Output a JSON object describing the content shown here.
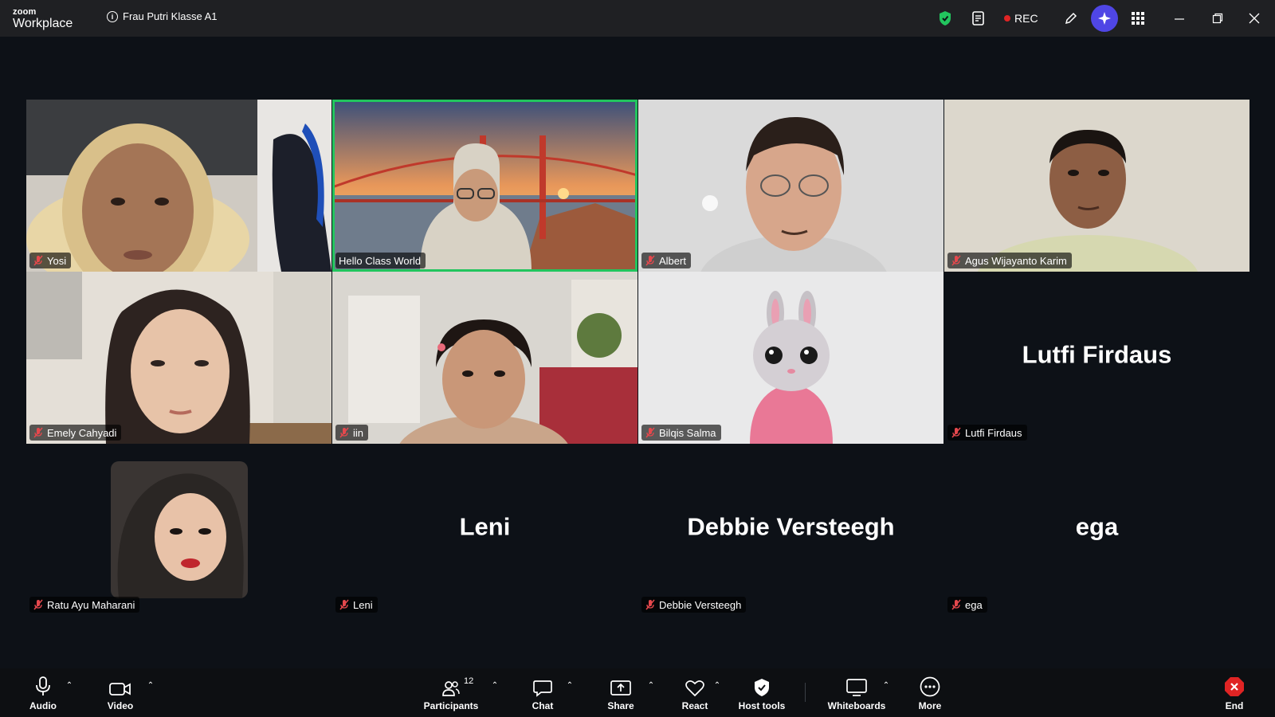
{
  "app": {
    "logo_line1": "zoom",
    "logo_line2": "Workplace"
  },
  "meeting": {
    "title": "Frau Putri Klasse A1"
  },
  "topbar": {
    "rec_label": "REC"
  },
  "participants": [
    {
      "name": "Yosi",
      "muted": true,
      "video": true,
      "scene": "yosi"
    },
    {
      "name": "Hello Class World",
      "muted": false,
      "video": true,
      "scene": "bridge",
      "active_speaker": true
    },
    {
      "name": "Albert",
      "muted": true,
      "video": true,
      "scene": "albert"
    },
    {
      "name": "Agus Wijayanto Karim",
      "muted": true,
      "video": true,
      "scene": "agus"
    },
    {
      "name": "Emely Cahyadi",
      "muted": true,
      "video": true,
      "scene": "emely"
    },
    {
      "name": "iin",
      "muted": true,
      "video": true,
      "scene": "iin"
    },
    {
      "name": "Bilqis Salma",
      "muted": true,
      "video": true,
      "scene": "bunny"
    },
    {
      "name": "Lutfi Firdaus",
      "muted": true,
      "video": false,
      "display_name": "Lutfi Firdaus"
    },
    {
      "name": "Ratu Ayu Maharani",
      "muted": true,
      "video": false,
      "scene": "avatar-photo"
    },
    {
      "name": "Leni",
      "muted": true,
      "video": false,
      "display_name": "Leni"
    },
    {
      "name": "Debbie Versteegh",
      "muted": true,
      "video": false,
      "display_name": "Debbie Versteegh"
    },
    {
      "name": "ega",
      "muted": true,
      "video": false,
      "display_name": "ega"
    }
  ],
  "toolbar": {
    "audio": "Audio",
    "video": "Video",
    "participants": "Participants",
    "participants_count": "12",
    "chat": "Chat",
    "share": "Share",
    "react": "React",
    "host_tools": "Host tools",
    "whiteboards": "Whiteboards",
    "more": "More",
    "end": "End"
  },
  "colors": {
    "active_speaker": "#22c55e",
    "rec_dot": "#e02424",
    "muted_mic": "#e5484d",
    "end": "#e02424",
    "shield": "#22c55e",
    "ai_companion": "#4f46e5"
  },
  "icons": [
    "info-icon",
    "shield-icon",
    "notes-icon",
    "record-dot-icon",
    "pencil-icon",
    "ai-companion-icon",
    "apps-grid-icon",
    "minimize-icon",
    "restore-icon",
    "close-icon",
    "mic-icon",
    "camera-icon",
    "participants-icon",
    "chat-icon",
    "share-icon",
    "heart-icon",
    "shield-host-icon",
    "whiteboard-icon",
    "more-icon",
    "end-icon",
    "mic-muted-icon"
  ]
}
